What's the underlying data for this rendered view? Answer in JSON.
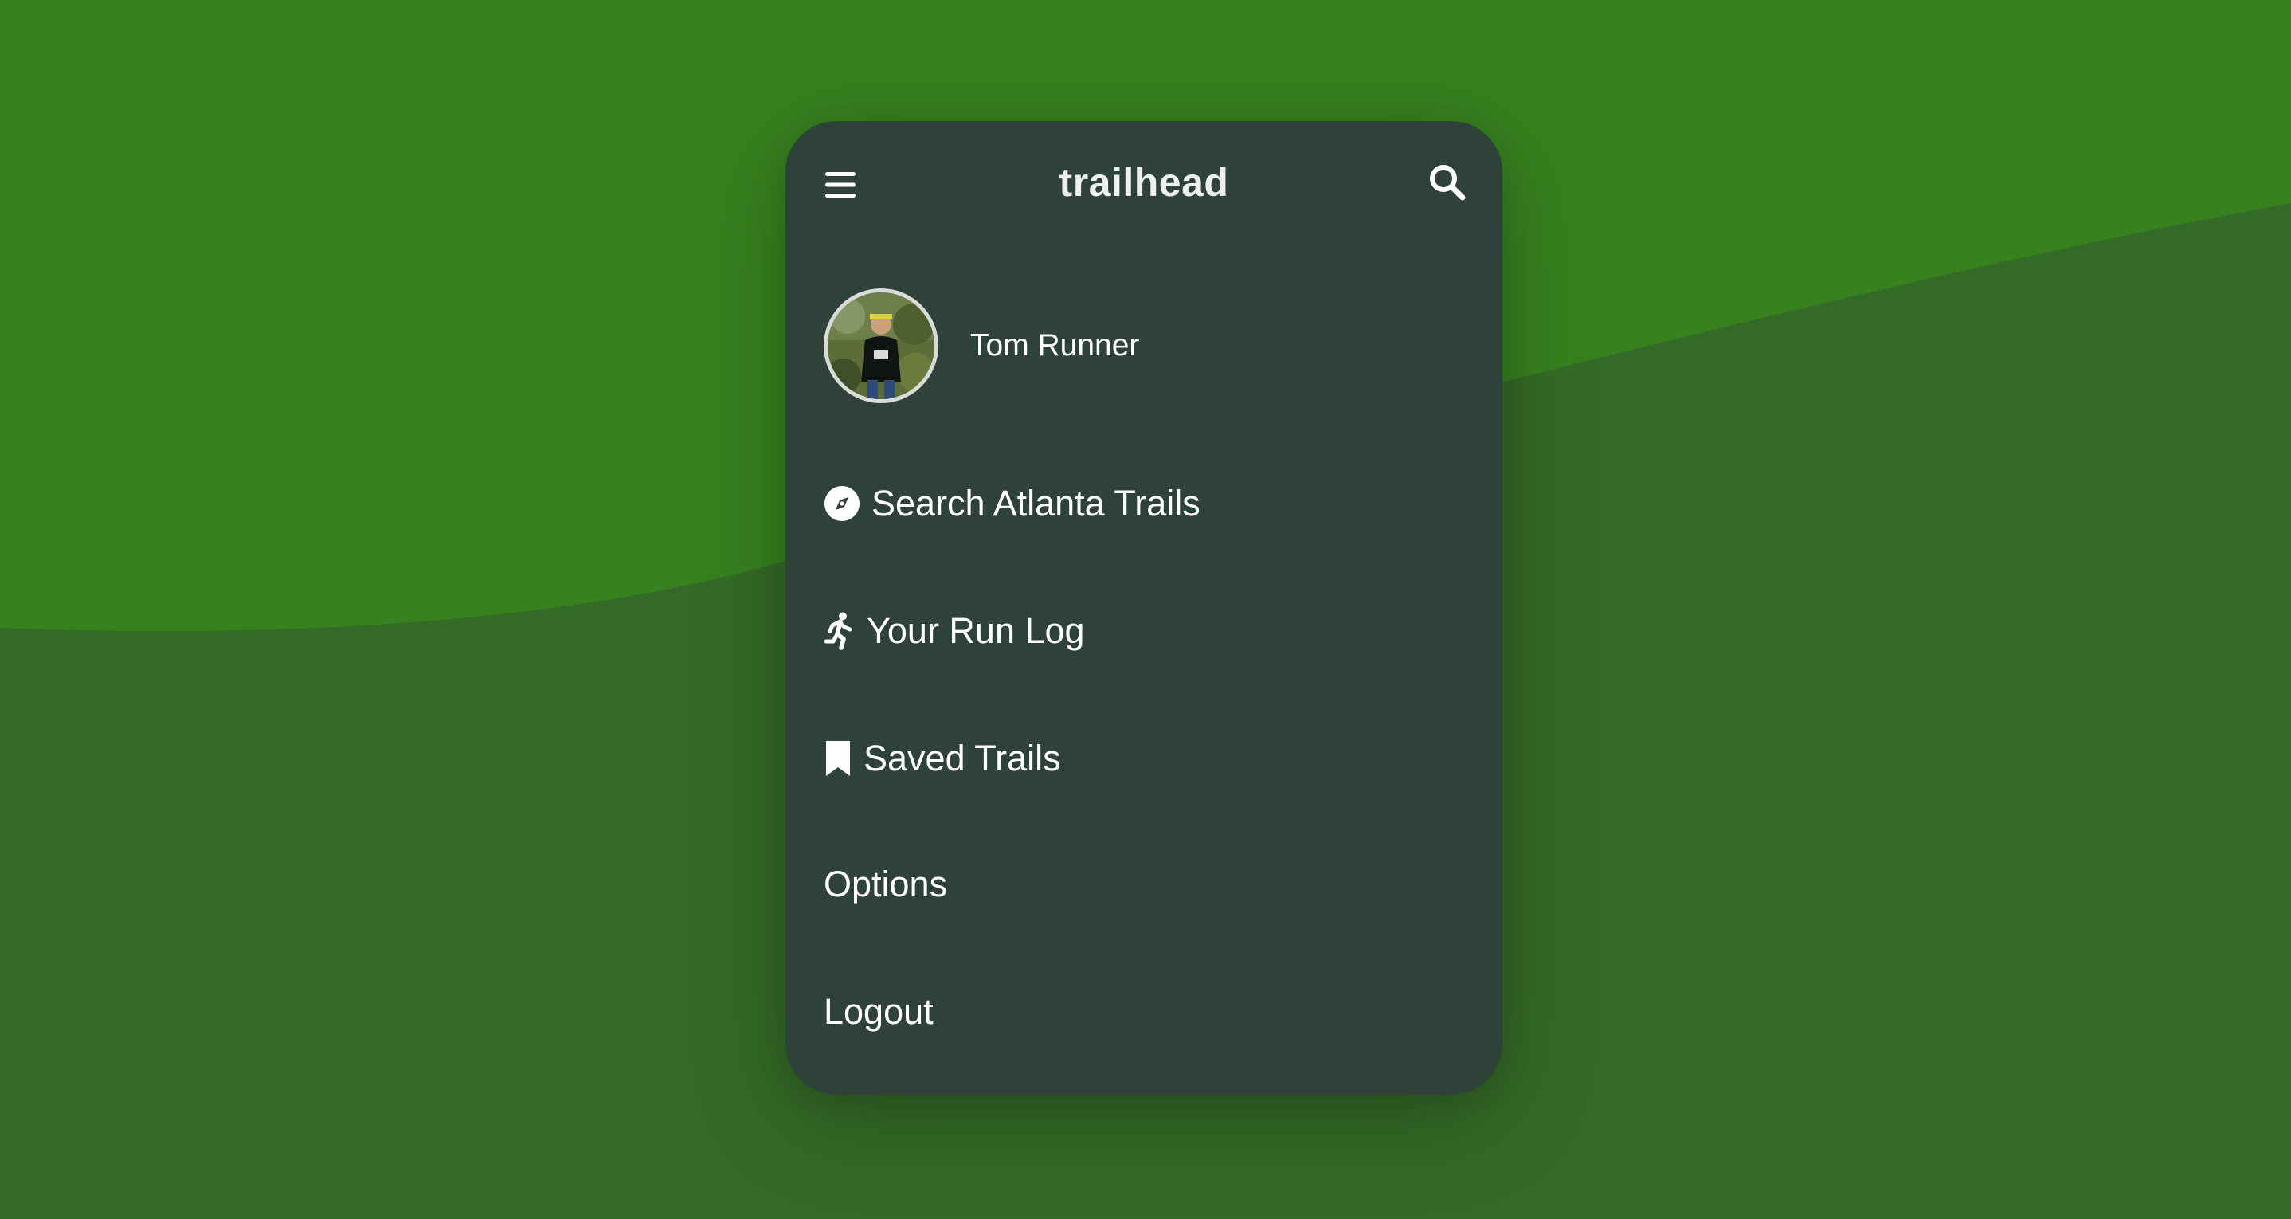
{
  "colors": {
    "background_top": "#37811f",
    "background_bottom": "#346a27",
    "card": "#2f4239",
    "text": "#ffffff"
  },
  "header": {
    "menu_icon": "hamburger-menu-icon",
    "title": "trailhead",
    "search_icon": "search-icon"
  },
  "profile": {
    "avatar": "profile-photo",
    "name": "Tom Runner"
  },
  "menu": {
    "items": [
      {
        "label": "Search Atlanta Trails",
        "icon": "compass-icon"
      },
      {
        "label": "Your Run Log",
        "icon": "running-person-icon"
      },
      {
        "label": "Saved Trails",
        "icon": "bookmark-icon"
      },
      {
        "label": "Options"
      },
      {
        "label": "Logout"
      }
    ]
  }
}
